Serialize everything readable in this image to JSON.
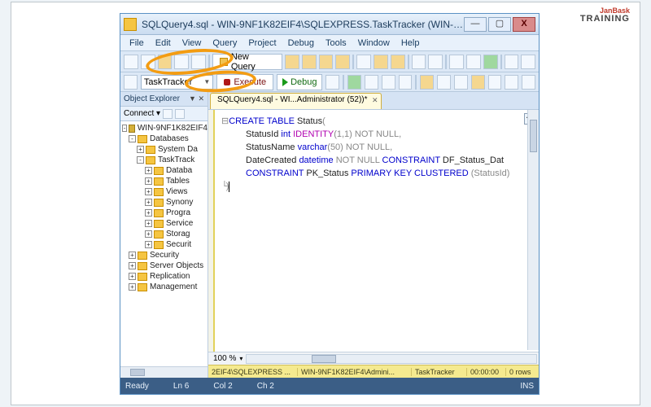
{
  "watermark": {
    "top": "JanBask",
    "sub": "TRAINING"
  },
  "window": {
    "title": "SQLQuery4.sql - WIN-9NF1K82EIF4\\SQLEXPRESS.TaskTracker (WIN-9NF1K...",
    "buttons": {
      "min": "—",
      "max": "▢",
      "close": "X"
    }
  },
  "menu": [
    "File",
    "Edit",
    "View",
    "Query",
    "Project",
    "Debug",
    "Tools",
    "Window",
    "Help"
  ],
  "toolbar": {
    "new_query": "New Query",
    "db_selected": "TaskTracker",
    "execute": "Execute",
    "debug": "Debug"
  },
  "object_explorer": {
    "title": "Object Explorer",
    "pin": "▼ ✕",
    "connect": "Connect ▾",
    "server": "WIN-9NF1K82EIF4",
    "nodes": {
      "databases": "Databases",
      "system_db": "System Da",
      "tasktracker": "TaskTrack",
      "children": [
        "Databa",
        "Tables",
        "Views",
        "Synony",
        "Progra",
        "Service",
        "Storag",
        "Securit"
      ],
      "siblings": [
        "Security",
        "Server Objects",
        "Replication",
        "Management"
      ]
    }
  },
  "tab": {
    "label": "SQLQuery4.sql - WI...Administrator (52))*"
  },
  "sql": {
    "l1a": "CREATE TABLE",
    "l1b": " Status",
    "l2a": "StatusId ",
    "l2b": "int",
    "l2c": " IDENTITY",
    "l2d": "(1,1)",
    "l2e": " NOT NULL",
    "l3a": "StatusName ",
    "l3b": "varchar",
    "l3c": "(50)",
    "l3d": " NOT NULL",
    "l4a": "DateCreated ",
    "l4b": "datetime",
    "l4c": " NOT NULL ",
    "l4d": "CONSTRAINT",
    "l4e": " DF_Status_Dat",
    "l5a": "CONSTRAINT",
    "l5b": " PK_Status ",
    "l5c": "PRIMARY KEY CLUSTERED ",
    "l5d": "(StatusId)",
    "l6": ")"
  },
  "zoom": "100 %",
  "status_yellow": {
    "s1": "2EIF4\\SQLEXPRESS ...",
    "s2": "WIN-9NF1K82EIF4\\Admini...",
    "s3": "TaskTracker",
    "s4": "00:00:00",
    "s5": "0 rows"
  },
  "statusbar": {
    "ready": "Ready",
    "ln": "Ln 6",
    "col": "Col 2",
    "ch": "Ch 2",
    "ins": "INS"
  }
}
